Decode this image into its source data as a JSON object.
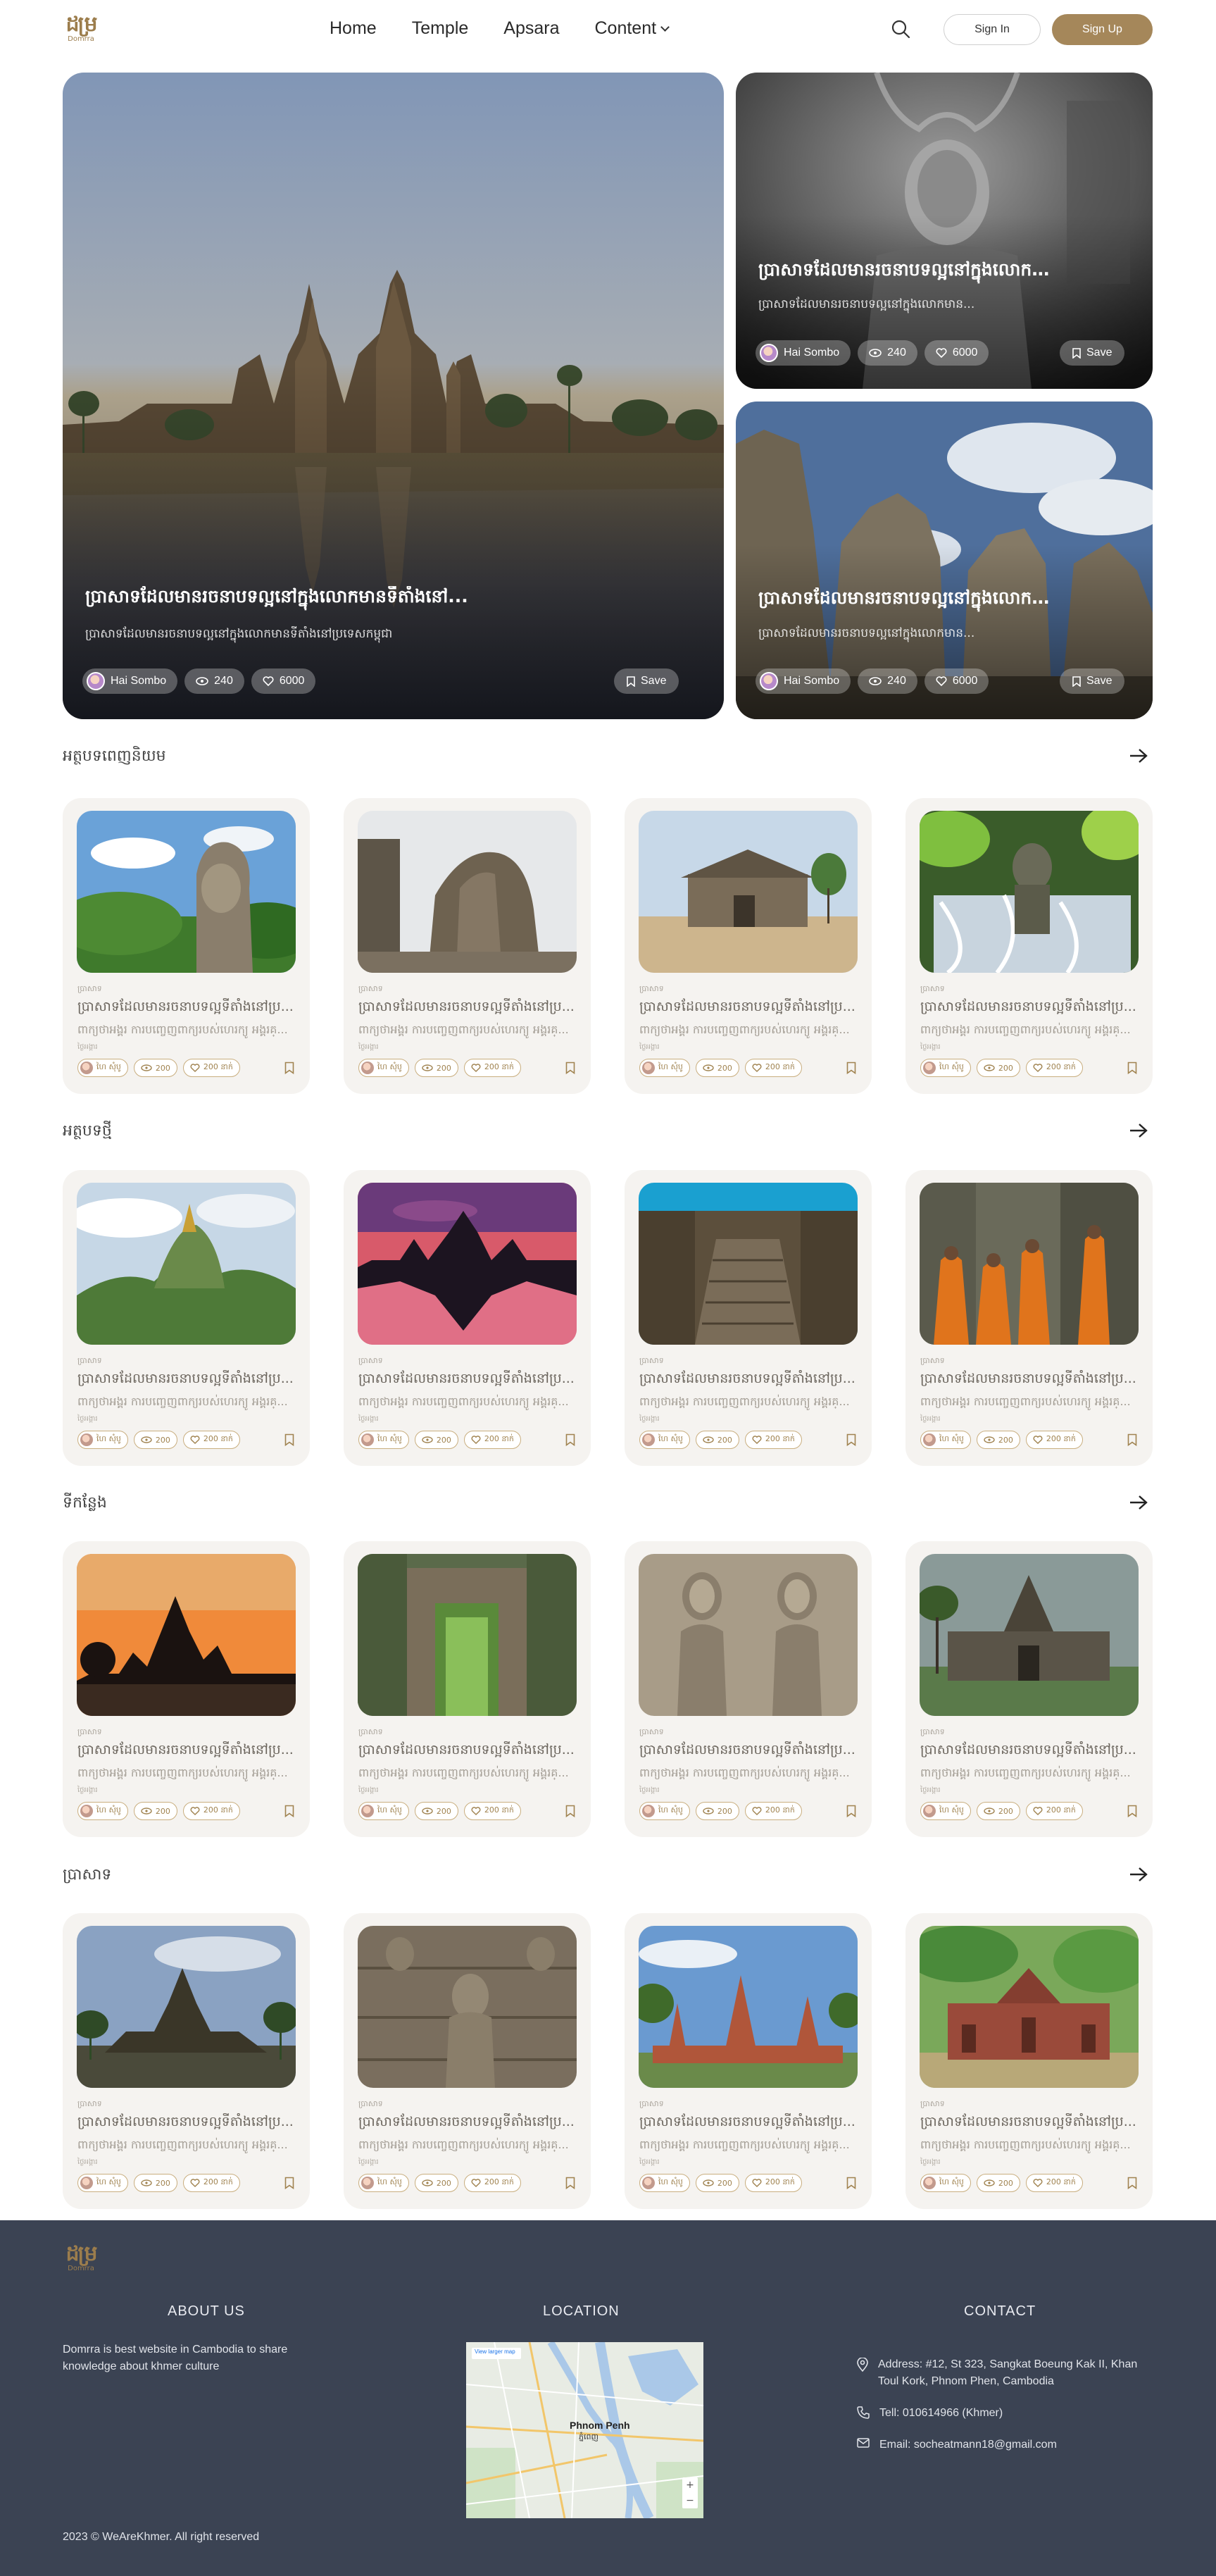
{
  "brand": {
    "logo_glyph": "ដម្រ",
    "logo_word": "Domrra"
  },
  "nav": {
    "links": [
      "Home",
      "Temple",
      "Apsara",
      "Content"
    ],
    "signin_label": "Sign In",
    "signup_label": "Sign Up"
  },
  "hero": {
    "main": {
      "title": "ប្រាសាទដែលមានរចនាបទល្អនៅក្នុងលោកមានទីតាំងនៅ...",
      "subtitle": "ប្រាសាទដែលមានរចនាបទល្អនៅក្នុងលោកមានទីតាំងនៅប្រទេសកម្ពុជា",
      "author": "Hai Sombo",
      "views": "240",
      "likes": "6000",
      "save_label": "Save"
    },
    "side1": {
      "title": "ប្រាសាទដែលមានរចនាបទល្អនៅក្នុងលោកមាន...",
      "subtitle": "ប្រាសាទដែលមានរចនាបទល្អនៅក្នុងលោកមាន...",
      "author": "Hai Sombo",
      "views": "240",
      "likes": "6000",
      "save_label": "Save"
    },
    "side2": {
      "title": "ប្រាសាទដែលមានរចនាបទល្អនៅក្នុងលោកមាន...",
      "subtitle": "ប្រាសាទដែលមានរចនាបទល្អនៅក្នុងលោកមាន...",
      "author": "Hai Sombo",
      "views": "240",
      "likes": "6000",
      "save_label": "Save"
    }
  },
  "card_text": {
    "category": "ប្រាសាទ",
    "title": "ប្រាសាទដែលមានរចនាបទល្អទីតាំងនៅប្រ...",
    "description": "ពាក្យថាអង្គរ​ ការបញ្ចេញពាក្យរបស់ហេរក្យូ អង្គរគ្...",
    "date": "ថ្ងៃអង្គារ",
    "author": "ហៃ សុំបូ",
    "views": "200",
    "likes": "200 នាក់"
  },
  "sections": [
    {
      "title": "អត្ថបទពេញនិយម"
    },
    {
      "title": "អត្ថបទថ្មី"
    },
    {
      "title": "ទីកន្លែង"
    },
    {
      "title": "ប្រាសាទ"
    }
  ],
  "footer": {
    "about_heading": "ABOUT US",
    "about_text": "Domrra is best website in Cambodia to share knowledge about khmer culture",
    "location_heading": "LOCATION",
    "map_label": "Phnom Penh",
    "map_label_kh": "ភ្នំពេញ",
    "map_chip": "View larger map",
    "contact_heading": "CONTACT",
    "address": "Address: #12, St 323, Sangkat Boeung Kak II, Khan Toul Kork, Phnom Phen, Cambodia",
    "phone": "Tell: 010614966 (Khmer)",
    "email": "Email: socheatmann18@gmail.com",
    "copyright": "2023 © WeAreKhmer. All right reserved"
  },
  "colors": {
    "accent": "#a5875a",
    "footer_bg": "#3b4353",
    "card_bg": "#f5f3f0"
  }
}
